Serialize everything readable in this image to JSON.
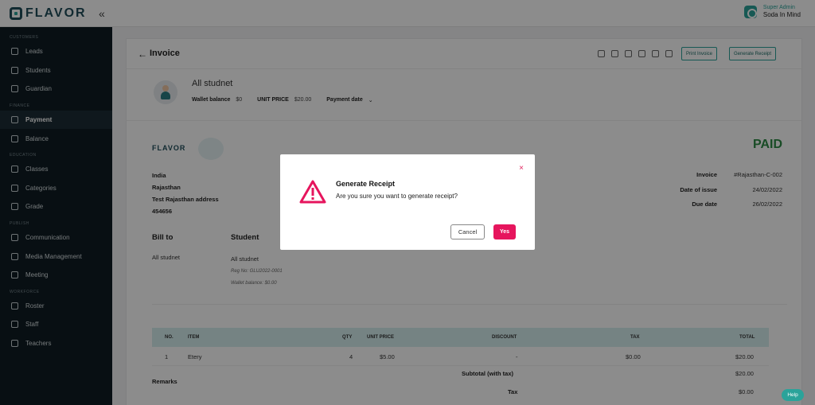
{
  "app": {
    "brand": "FLAVOR"
  },
  "user": {
    "role": "Super Admin",
    "name": "Soda In Mind"
  },
  "sidebar": {
    "sections": [
      {
        "title": "CUSTOMERS",
        "items": [
          {
            "label": "Leads",
            "icon": "leads-icon"
          },
          {
            "label": "Students",
            "icon": "students-icon"
          },
          {
            "label": "Guardian",
            "icon": "guardian-icon"
          }
        ]
      },
      {
        "title": "FINANCE",
        "items": [
          {
            "label": "Payment",
            "icon": "payment-icon",
            "active": true
          },
          {
            "label": "Balance",
            "icon": "balance-icon"
          }
        ]
      },
      {
        "title": "EDUCATION",
        "items": [
          {
            "label": "Classes",
            "icon": "classes-icon"
          },
          {
            "label": "Categories",
            "icon": "categories-icon"
          },
          {
            "label": "Grade",
            "icon": "grade-icon"
          }
        ]
      },
      {
        "title": "PUBLISH",
        "items": [
          {
            "label": "Communication",
            "icon": "communication-icon"
          },
          {
            "label": "Media Management",
            "icon": "media-icon"
          },
          {
            "label": "Meeting",
            "icon": "meeting-icon"
          }
        ]
      },
      {
        "title": "WORKFORCE",
        "items": [
          {
            "label": "Roster",
            "icon": "roster-icon"
          },
          {
            "label": "Staff",
            "icon": "staff-icon"
          },
          {
            "label": "Teachers",
            "icon": "teachers-icon"
          }
        ]
      }
    ]
  },
  "invoice": {
    "title": "Invoice",
    "print_label": "Print Invoice",
    "generate_label": "Generate Receipt",
    "student_name": "All studnet",
    "wallet_label": "Wallet balance",
    "wallet_value": "$0",
    "unit_price_label": "UNIT PRICE",
    "unit_price_value": "$20.00",
    "payment_date_label": "Payment date",
    "brand_mini": "FLAVOR",
    "status": "PAID",
    "address": [
      "India",
      "Rajasthan",
      "Test Rajasthan address",
      "454656"
    ],
    "info": [
      {
        "label": "Invoice",
        "value": "#Rajasthan-C-002"
      },
      {
        "label": "Date of issue",
        "value": "24/02/2022"
      },
      {
        "label": "Due date",
        "value": "26/02/2022"
      }
    ],
    "bill_to_label": "Bill to",
    "bill_to_name": "All studnet",
    "student_label": "Student",
    "student_block": {
      "name": "All studnet",
      "reg": "Reg No: GLU2022-0001",
      "wallet": "Wallet balance: $0.00"
    },
    "table": {
      "headers": [
        "NO.",
        "ITEM",
        "QTY",
        "UNIT PRICE",
        "DISCOUNT",
        "TAX",
        "TOTAL"
      ],
      "rows": [
        [
          "1",
          "Etery",
          "4",
          "$5.00",
          "-",
          "$0.00",
          "$20.00"
        ]
      ]
    },
    "remarks_label": "Remarks",
    "subtotal_label": "Subtotal (with tax)",
    "subtotal_value": "$20.00",
    "tax_label": "Tax",
    "tax_value": "$0.00"
  },
  "modal": {
    "title": "Generate Receipt",
    "message": "Are you sure you want to generate receipt?",
    "cancel_label": "Cancel",
    "yes_label": "Yes",
    "close_glyph": "×"
  },
  "help_label": "Help",
  "colors": {
    "accent": "#2aa39a",
    "danger": "#e6155d",
    "sidebar": "#0f1d24",
    "paid": "#2f8a46"
  }
}
